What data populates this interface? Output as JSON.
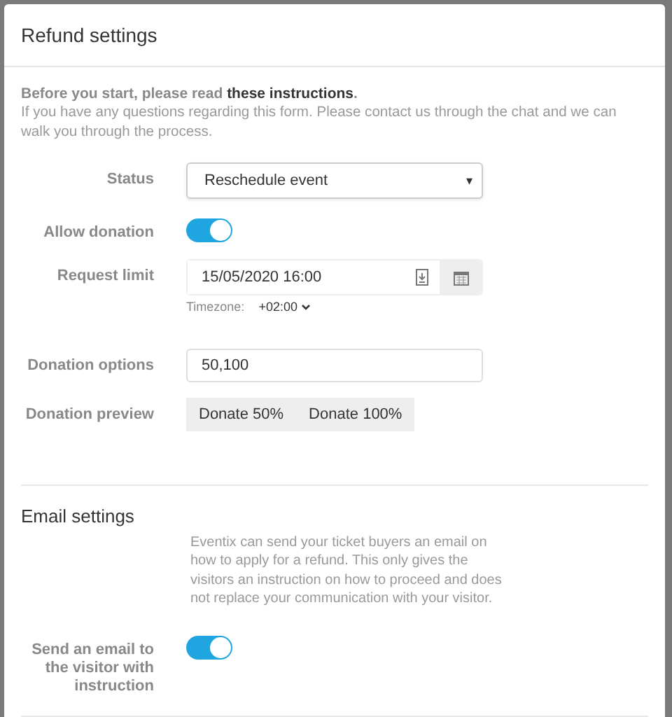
{
  "window": {
    "title": "Refund settings"
  },
  "intro": {
    "lead": "Before you start, please read **these instructions**.",
    "text": "If you have any questions regarding this form. Please contact us through the chat and we can walk you through the process."
  },
  "fields": [
    {
      "kind": "select",
      "label": "Status",
      "value": "Reschedule event",
      "caret": "▾"
    },
    {
      "kind": "toggle",
      "label": "Allow donation",
      "on": true
    },
    {
      "kind": "datetime",
      "label": "Request limit",
      "value": "15/05/2020 16:00",
      "timezone_label": "Timezone:",
      "timezone": "+02:00"
    },
    {
      "kind": "text",
      "label": "Donation options",
      "value": "50,100"
    },
    {
      "kind": "buttons",
      "label": "Donation preview",
      "buttons": [
        "Donate 50%",
        "Donate 100%"
      ]
    }
  ],
  "email": {
    "title": "Email settings",
    "description": "Eventix can send your ticket buyers an email on how to apply for a refund. This only gives the visitors an instruction on how to proceed and does not replace your communication with your visitor.",
    "fields": [
      {
        "kind": "toggle",
        "label": "Send an email to the visitor with instruction",
        "on": true
      }
    ]
  }
}
